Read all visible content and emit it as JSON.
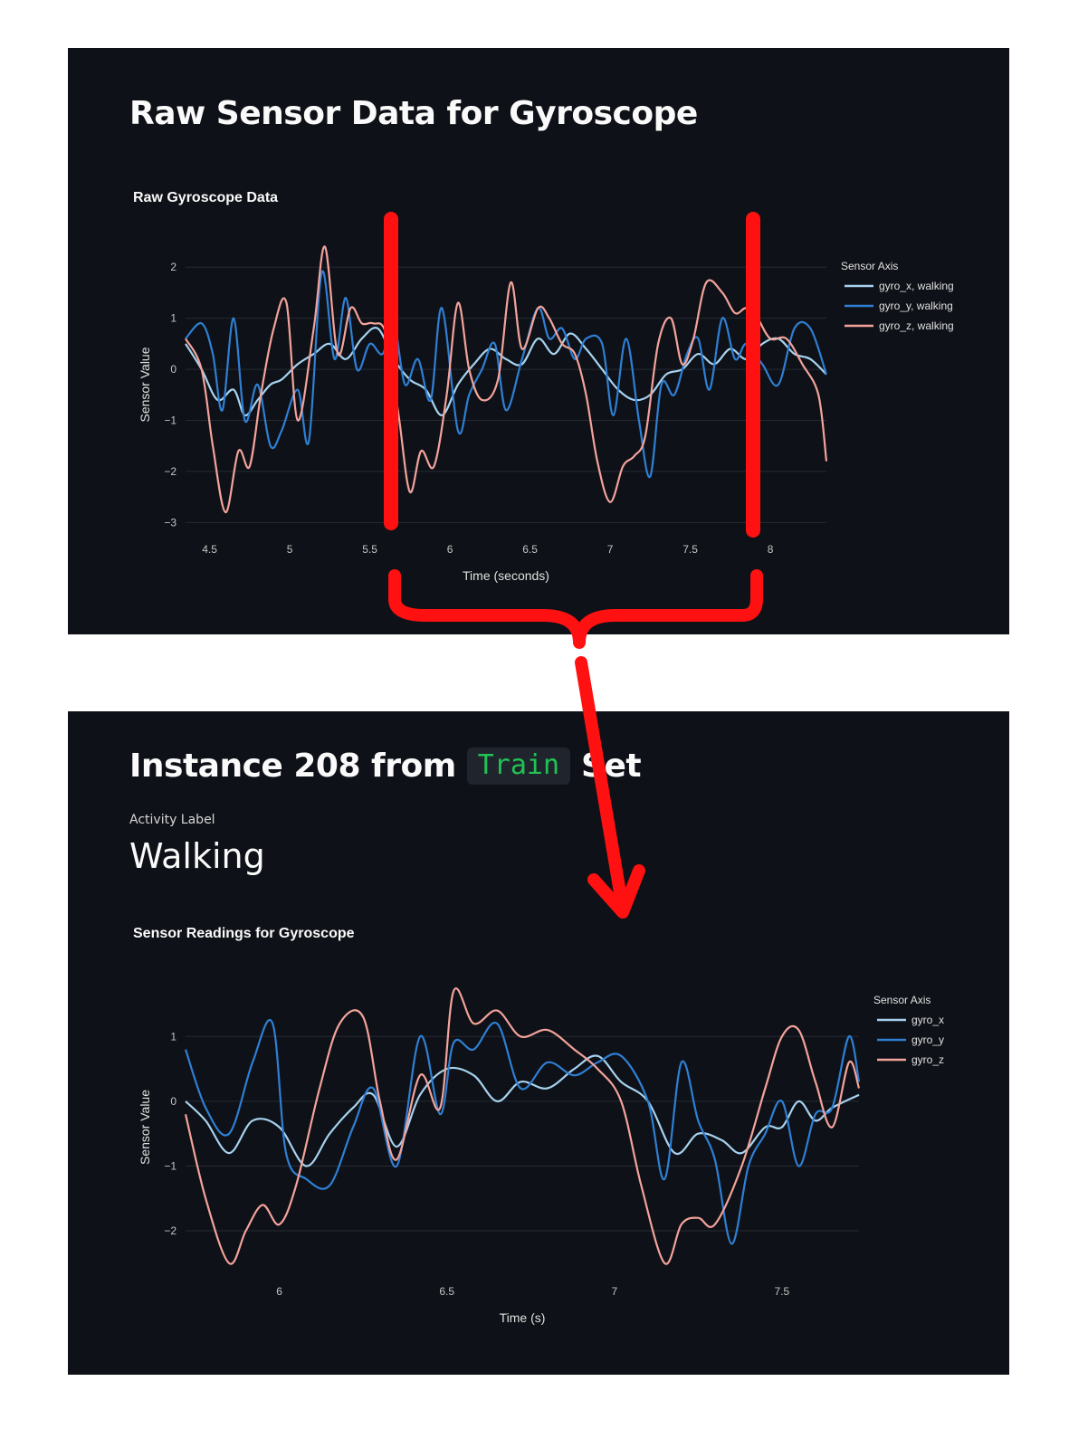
{
  "top_panel": {
    "title": "Raw Sensor Data for Gyroscope"
  },
  "bottom_panel": {
    "title_prefix": "Instance 208 from",
    "title_code": "Train",
    "title_suffix": "Set",
    "activity_label": "Activity Label",
    "activity_value": "Walking"
  },
  "colors": {
    "x": "#a6d2ef",
    "y": "#2f7fd3",
    "z": "#f3a39b",
    "annotation": "#ff1111",
    "background": "#0e1117",
    "grid": "#262a33"
  },
  "chart_data": [
    {
      "type": "line",
      "title": "Raw Gyroscope Data",
      "xlabel": "Time (seconds)",
      "ylabel": "Sensor Value",
      "xlim": [
        4.35,
        8.35
      ],
      "ylim": [
        -3.1,
        2.5
      ],
      "x_ticks": [
        4.5,
        5,
        5.5,
        6,
        6.5,
        7,
        7.5,
        8
      ],
      "x_tick_labels": [
        "4.5",
        "5",
        "5.5",
        "6",
        "6.5",
        "7",
        "7.5",
        "8"
      ],
      "y_ticks": [
        -3,
        -2,
        -1,
        0,
        1,
        2
      ],
      "y_tick_labels": [
        "−3",
        "−2",
        "−1",
        "0",
        "1",
        "2"
      ],
      "grid": true,
      "legend_title": "Sensor Axis",
      "legend_position": "right",
      "series": [
        {
          "name": "gyro_x, walking",
          "x": [
            4.35,
            4.45,
            4.55,
            4.65,
            4.72,
            4.8,
            4.88,
            4.95,
            5.05,
            5.15,
            5.25,
            5.35,
            5.45,
            5.55,
            5.65,
            5.75,
            5.85,
            5.95,
            6.05,
            6.15,
            6.25,
            6.35,
            6.45,
            6.55,
            6.65,
            6.75,
            6.85,
            6.95,
            7.05,
            7.15,
            7.25,
            7.35,
            7.45,
            7.55,
            7.65,
            7.75,
            7.85,
            7.95,
            8.05,
            8.15,
            8.25,
            8.35
          ],
          "values": [
            0.5,
            0.0,
            -0.6,
            -0.4,
            -0.9,
            -0.6,
            -0.3,
            -0.2,
            0.1,
            0.3,
            0.5,
            0.2,
            0.6,
            0.8,
            0.2,
            -0.2,
            -0.4,
            -0.9,
            -0.3,
            0.1,
            0.4,
            0.2,
            0.1,
            0.6,
            0.3,
            0.7,
            0.4,
            0.0,
            -0.4,
            -0.6,
            -0.5,
            -0.1,
            0.0,
            0.3,
            0.1,
            0.4,
            0.2,
            0.5,
            0.6,
            0.3,
            0.2,
            -0.1
          ]
        },
        {
          "name": "gyro_y, walking",
          "x": [
            4.35,
            4.45,
            4.52,
            4.58,
            4.65,
            4.72,
            4.8,
            4.88,
            4.95,
            5.05,
            5.12,
            5.2,
            5.28,
            5.35,
            5.42,
            5.5,
            5.58,
            5.65,
            5.72,
            5.8,
            5.88,
            5.95,
            6.05,
            6.12,
            6.2,
            6.28,
            6.35,
            6.45,
            6.55,
            6.62,
            6.7,
            6.78,
            6.85,
            6.95,
            7.02,
            7.1,
            7.18,
            7.25,
            7.32,
            7.4,
            7.48,
            7.55,
            7.62,
            7.7,
            7.78,
            7.85,
            7.95,
            8.05,
            8.15,
            8.25,
            8.35
          ],
          "values": [
            0.6,
            0.9,
            0.3,
            -0.8,
            1.0,
            -1.0,
            -0.3,
            -1.5,
            -1.2,
            -0.4,
            -1.4,
            1.9,
            0.2,
            1.4,
            0.0,
            0.5,
            0.3,
            0.9,
            -0.3,
            0.2,
            -0.6,
            1.2,
            -1.2,
            -0.5,
            0.0,
            0.5,
            -0.8,
            0.2,
            1.2,
            0.6,
            0.8,
            0.2,
            0.6,
            0.5,
            -0.9,
            0.6,
            -1.0,
            -2.1,
            -0.3,
            -0.5,
            0.3,
            0.6,
            -0.4,
            1.0,
            0.2,
            0.5,
            0.1,
            -0.3,
            0.8,
            0.8,
            -0.1
          ]
        },
        {
          "name": "gyro_z, walking",
          "x": [
            4.35,
            4.45,
            4.52,
            4.6,
            4.68,
            4.75,
            4.82,
            4.9,
            4.98,
            5.05,
            5.15,
            5.22,
            5.3,
            5.38,
            5.45,
            5.52,
            5.6,
            5.68,
            5.75,
            5.82,
            5.9,
            5.98,
            6.05,
            6.12,
            6.2,
            6.3,
            6.38,
            6.45,
            6.55,
            6.62,
            6.7,
            6.78,
            6.85,
            6.92,
            7.0,
            7.08,
            7.15,
            7.22,
            7.3,
            7.38,
            7.45,
            7.52,
            7.6,
            7.7,
            7.78,
            7.85,
            7.92,
            8.0,
            8.1,
            8.2,
            8.3,
            8.35
          ],
          "values": [
            0.6,
            0.0,
            -1.5,
            -2.8,
            -1.6,
            -1.9,
            -0.5,
            0.8,
            1.3,
            -1.0,
            0.8,
            2.4,
            0.3,
            1.2,
            0.9,
            0.9,
            0.7,
            -0.9,
            -2.4,
            -1.6,
            -1.9,
            -0.5,
            1.3,
            0.0,
            -0.6,
            -0.2,
            1.7,
            0.4,
            1.2,
            1.0,
            0.5,
            0.3,
            -0.5,
            -1.8,
            -2.6,
            -1.9,
            -1.7,
            -1.3,
            0.5,
            1.0,
            0.1,
            0.6,
            1.7,
            1.5,
            1.1,
            1.2,
            1.0,
            0.6,
            0.6,
            0.1,
            -0.5,
            -1.8
          ]
        }
      ]
    },
    {
      "type": "line",
      "title": "Sensor Readings for Gyroscope",
      "xlabel": "Time (s)",
      "ylabel": "Sensor Value",
      "xlim": [
        5.72,
        7.73
      ],
      "ylim": [
        -2.6,
        1.8
      ],
      "x_ticks": [
        6,
        6.5,
        7,
        7.5
      ],
      "x_tick_labels": [
        "6",
        "6.5",
        "7",
        "7.5"
      ],
      "y_ticks": [
        -2,
        -1,
        0,
        1
      ],
      "y_tick_labels": [
        "−2",
        "−1",
        "0",
        "1"
      ],
      "grid": true,
      "legend_title": "Sensor Axis",
      "legend_position": "right",
      "series": [
        {
          "name": "gyro_x",
          "x": [
            5.72,
            5.78,
            5.85,
            5.92,
            6.0,
            6.08,
            6.15,
            6.22,
            6.28,
            6.35,
            6.42,
            6.5,
            6.58,
            6.65,
            6.72,
            6.8,
            6.88,
            6.95,
            7.02,
            7.1,
            7.18,
            7.25,
            7.32,
            7.38,
            7.45,
            7.5,
            7.55,
            7.6,
            7.65,
            7.73
          ],
          "values": [
            0.0,
            -0.3,
            -0.8,
            -0.3,
            -0.4,
            -1.0,
            -0.5,
            -0.1,
            0.1,
            -0.7,
            0.1,
            0.5,
            0.4,
            0.0,
            0.3,
            0.2,
            0.5,
            0.7,
            0.3,
            0.0,
            -0.8,
            -0.5,
            -0.6,
            -0.8,
            -0.4,
            -0.4,
            0.0,
            -0.3,
            -0.1,
            0.1
          ]
        },
        {
          "name": "gyro_y",
          "x": [
            5.72,
            5.78,
            5.85,
            5.92,
            5.98,
            6.02,
            6.08,
            6.15,
            6.22,
            6.28,
            6.35,
            6.42,
            6.48,
            6.52,
            6.58,
            6.65,
            6.72,
            6.8,
            6.88,
            6.95,
            7.02,
            7.1,
            7.15,
            7.2,
            7.25,
            7.3,
            7.35,
            7.4,
            7.45,
            7.5,
            7.55,
            7.6,
            7.65,
            7.7,
            7.73
          ],
          "values": [
            0.8,
            -0.1,
            -0.5,
            0.6,
            1.2,
            -0.8,
            -1.2,
            -1.3,
            -0.4,
            0.2,
            -1.0,
            1.0,
            -0.2,
            0.9,
            0.8,
            1.2,
            0.2,
            0.6,
            0.4,
            0.6,
            0.7,
            0.0,
            -1.2,
            0.6,
            -0.3,
            -0.9,
            -2.2,
            -1.0,
            -0.5,
            0.0,
            -1.0,
            -0.2,
            -0.1,
            1.0,
            0.3
          ]
        },
        {
          "name": "gyro_z",
          "x": [
            5.72,
            5.78,
            5.85,
            5.9,
            5.95,
            6.0,
            6.05,
            6.12,
            6.18,
            6.25,
            6.3,
            6.35,
            6.42,
            6.48,
            6.52,
            6.58,
            6.65,
            6.72,
            6.8,
            6.88,
            6.95,
            7.02,
            7.08,
            7.15,
            7.2,
            7.25,
            7.3,
            7.38,
            7.45,
            7.5,
            7.55,
            7.6,
            7.65,
            7.7,
            7.73
          ],
          "values": [
            -0.2,
            -1.5,
            -2.5,
            -2.0,
            -1.6,
            -1.9,
            -1.3,
            0.2,
            1.2,
            1.3,
            0.0,
            -0.9,
            0.4,
            -0.1,
            1.7,
            1.2,
            1.4,
            1.0,
            1.1,
            0.8,
            0.5,
            0.0,
            -1.3,
            -2.5,
            -1.9,
            -1.8,
            -1.9,
            -1.0,
            0.2,
            1.0,
            1.1,
            0.3,
            -0.4,
            0.6,
            0.2
          ]
        }
      ]
    }
  ]
}
